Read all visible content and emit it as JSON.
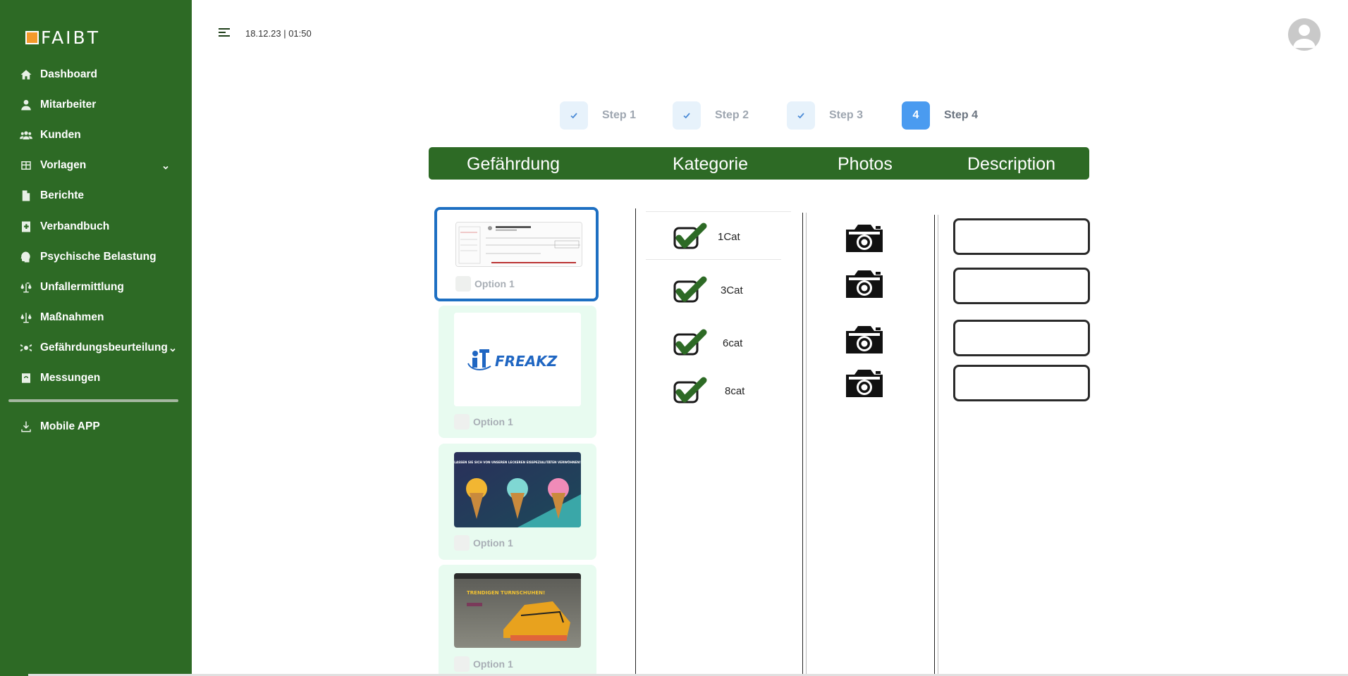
{
  "brand": {
    "logo_text": "FAIBT",
    "accent": "#f39a2b",
    "sidebar_color": "#2d6a25"
  },
  "sidebar": {
    "items": [
      {
        "label": "Dashboard",
        "icon": "home-icon"
      },
      {
        "label": "Mitarbeiter",
        "icon": "user-icon"
      },
      {
        "label": "Kunden",
        "icon": "users-icon"
      },
      {
        "label": "Vorlagen",
        "icon": "table-icon",
        "expandable": true
      },
      {
        "label": "Berichte",
        "icon": "file-icon"
      },
      {
        "label": "Verbandbuch",
        "icon": "medical-book-icon"
      },
      {
        "label": "Psychische Belastung",
        "icon": "brain-icon"
      },
      {
        "label": "Unfallermittlung",
        "icon": "scale-icon"
      },
      {
        "label": "Maßnahmen",
        "icon": "scale-icon"
      },
      {
        "label": "Gefährdungsbeurteilung",
        "icon": "hazard-gear-icon",
        "expandable": true
      },
      {
        "label": "Messungen",
        "icon": "measure-icon"
      }
    ],
    "mobile_app": {
      "label": "Mobile APP",
      "icon": "download-icon"
    }
  },
  "topbar": {
    "datetime": "18.12.23 | 01:50"
  },
  "stepper": {
    "steps": [
      {
        "label": "Step 1",
        "state": "done"
      },
      {
        "label": "Step 2",
        "state": "done"
      },
      {
        "label": "Step 3",
        "state": "done"
      },
      {
        "label": "Step 4",
        "state": "active",
        "number": "4"
      }
    ]
  },
  "table": {
    "headers": [
      "Gefährdung",
      "Kategorie",
      "Photos",
      "Description"
    ],
    "gefaehrdung": [
      {
        "option": "Option 1",
        "selected": true,
        "thumb": "cheque-image"
      },
      {
        "option": "Option 1",
        "selected": false,
        "thumb": "itfreakz-logo",
        "thumb_text": "FREAKZ"
      },
      {
        "option": "Option 1",
        "selected": false,
        "thumb": "icecream-banner",
        "thumb_text": "LASSEN SIE SICH VON UNSEREN LECKEREN EISSPEZIALITÄTEN VERWÖHNEN!"
      },
      {
        "option": "Option 1",
        "selected": false,
        "thumb": "sneaker-banner",
        "thumb_text": "TRENDIGEN TURNSCHUHEN!"
      }
    ],
    "kategorie": [
      {
        "label": "1Cat",
        "checked": true
      },
      {
        "label": "3Cat",
        "checked": true
      },
      {
        "label": "6cat",
        "checked": true
      },
      {
        "label": "8cat",
        "checked": true
      }
    ],
    "photos_count": 4,
    "descriptions": [
      "",
      "",
      "",
      ""
    ]
  }
}
